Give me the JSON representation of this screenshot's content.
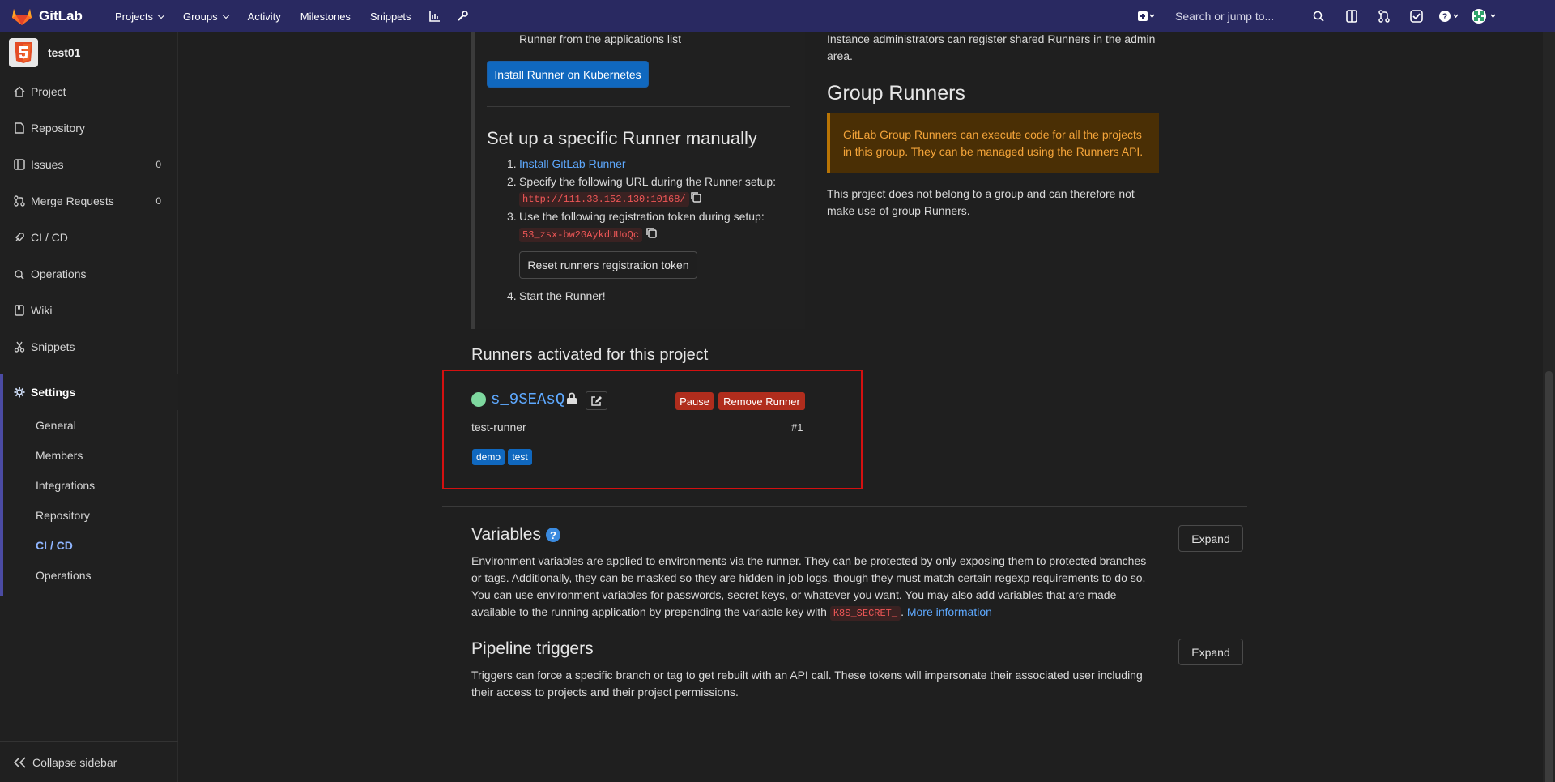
{
  "nav": {
    "brand": "GitLab",
    "links": [
      "Projects",
      "Groups",
      "Activity",
      "Milestones",
      "Snippets"
    ],
    "search_placeholder": "Search or jump to..."
  },
  "sidebar": {
    "project_name": "test01",
    "items": [
      {
        "label": "Project",
        "icon": "home-icon"
      },
      {
        "label": "Repository",
        "icon": "doc-icon"
      },
      {
        "label": "Issues",
        "icon": "issues-icon",
        "count": "0"
      },
      {
        "label": "Merge Requests",
        "icon": "merge-request-icon",
        "count": "0"
      },
      {
        "label": "CI / CD",
        "icon": "rocket-icon"
      },
      {
        "label": "Operations",
        "icon": "cloud-gear-icon"
      },
      {
        "label": "Wiki",
        "icon": "book-icon"
      },
      {
        "label": "Snippets",
        "icon": "scissors-icon"
      },
      {
        "label": "Settings",
        "icon": "gear-icon"
      }
    ],
    "settings_sub": [
      "General",
      "Members",
      "Integrations",
      "Repository",
      "CI / CD",
      "Operations"
    ],
    "collapse_label": "Collapse sidebar"
  },
  "specific": {
    "top_text": "Runner from the applications list",
    "install_k8s": "Install Runner on Kubernetes",
    "title": "Set up a specific Runner manually",
    "step1_num": "1.",
    "step1_link": "Install GitLab Runner",
    "step2_num": "2.",
    "step2": "Specify the following URL during the Runner setup:",
    "url": "http://111.33.152.130:10168/",
    "step3_num": "3.",
    "step3": "Use the following registration token during setup:",
    "token": "53_zsx-bw2GAykdUUoQc",
    "reset_btn": "Reset runners registration token",
    "step4_num": "4.",
    "step4": "Start the Runner!"
  },
  "shared": {
    "text": "Instance administrators can register shared Runners in the admin area."
  },
  "group": {
    "title": "Group Runners",
    "warning": "GitLab Group Runners can execute code for all the projects in this group. They can be managed using the Runners API.",
    "text": "This project does not belong to a group and can therefore not make use of group Runners."
  },
  "activated": {
    "title": "Runners activated for this project",
    "runner_id": "s_9SEAsQ",
    "pause": "Pause",
    "remove": "Remove Runner",
    "description": "test-runner",
    "number": "#1",
    "tags": [
      "demo",
      "test"
    ],
    "status_color": "#7ed89f"
  },
  "variables": {
    "title": "Variables",
    "expand": "Expand",
    "text_before": "Environment variables are applied to environments via the runner. They can be protected by only exposing them to protected branches or tags. Additionally, they can be masked so they are hidden in job logs, though they must match certain regexp requirements to do so. You can use environment variables for passwords, secret keys, or whatever you want. You may also add variables that are made available to the running application by prepending the variable key with",
    "code": "K8S_SECRET_",
    "dot": ".",
    "more": "More information"
  },
  "triggers": {
    "title": "Pipeline triggers",
    "expand": "Expand",
    "text": "Triggers can force a specific branch or tag to get rebuilt with an API call. These tokens will impersonate their associated user including their access to projects and their project permissions."
  },
  "colors": {
    "navbar": "#292961",
    "link": "#5ea9ff",
    "highlight_box": "#d41010",
    "danger_button": "#b02d1d",
    "primary_button": "#1068bf"
  }
}
